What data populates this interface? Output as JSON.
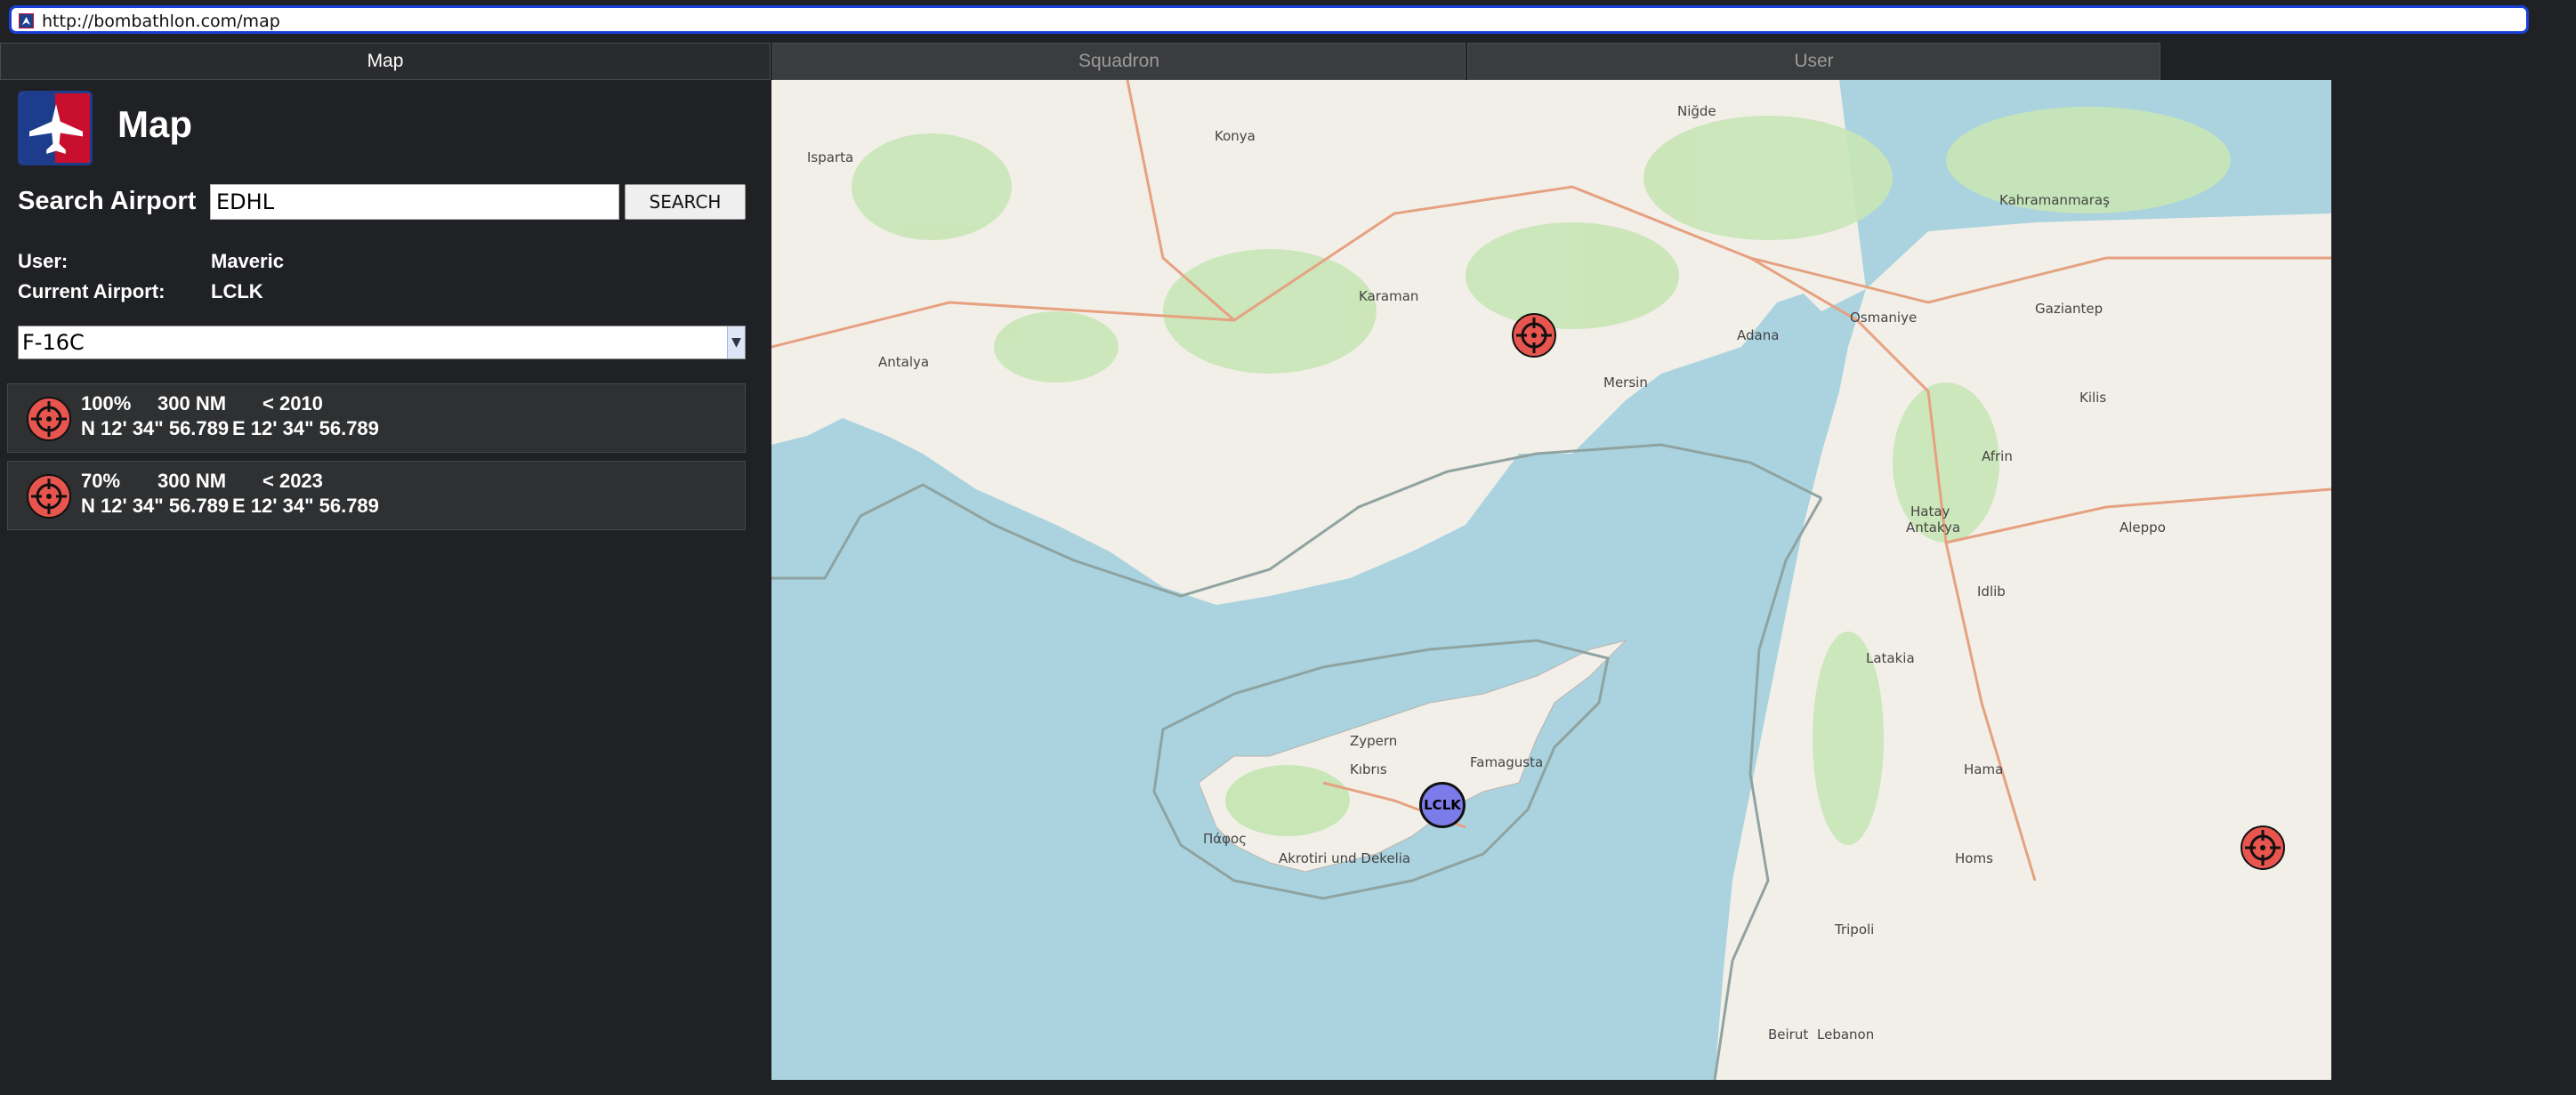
{
  "browser": {
    "url": "http://bombathlon.com/map"
  },
  "tabs": [
    {
      "label": "Map",
      "active": true
    },
    {
      "label": "Squadron",
      "active": false
    },
    {
      "label": "User",
      "active": false
    }
  ],
  "header": {
    "title": "Map",
    "logo_icon": "bombathlon-jet-logo-icon"
  },
  "search": {
    "label": "Search Airport",
    "value": "EDHL",
    "button_label": "SEARCH"
  },
  "info": {
    "user_label": "User:",
    "user_value": "Maveric",
    "airport_label": "Current Airport:",
    "airport_value": "LCLK"
  },
  "aircraft_select": {
    "selected": "F-16C"
  },
  "missions": [
    {
      "icon": "target-crosshair-icon",
      "chance": "100%",
      "distance": "300 NM",
      "year": "< 2010",
      "lat": "N 12' 34\" 56.789",
      "lon": "E 12' 34\" 56.789"
    },
    {
      "icon": "target-crosshair-icon",
      "chance": "70%",
      "distance": "300 NM",
      "year": "< 2023",
      "lat": "N 12' 34\" 56.789",
      "lon": "E 12' 34\" 56.789"
    }
  ],
  "map": {
    "airport_marker": "LCLK",
    "marker_color": "#7b7bea",
    "target_color": "#e8554e",
    "water_color": "#aad3df",
    "land_color": "#f2efe9",
    "labels": {
      "isparta": "Isparta",
      "konya": "Konya",
      "nigde": "Niğde",
      "kahramanmaras": "Kahramanmaraş",
      "karaman": "Karaman",
      "antalya": "Antalya",
      "mersin": "Mersin",
      "adana": "Adana",
      "osmaniye": "Osmaniye",
      "gaziantep": "Gaziantep",
      "kilis": "Kilis",
      "afrin": "Afrin",
      "hatay": "Hatay",
      "antakya": "Antakya",
      "aleppo": "Aleppo",
      "idlib": "Idlib",
      "latakia": "Latakia",
      "hama": "Hama",
      "homs": "Homs",
      "tripoli": "Tripoli",
      "beirut": "Beirut",
      "lebanon": "Lebanon",
      "cyprus": "Zypern",
      "kibris": "Kıbrıs",
      "famagusta": "Famagusta",
      "paphos": "Πάφος",
      "akrotiri": "Akrotiri und Dekelia"
    }
  }
}
